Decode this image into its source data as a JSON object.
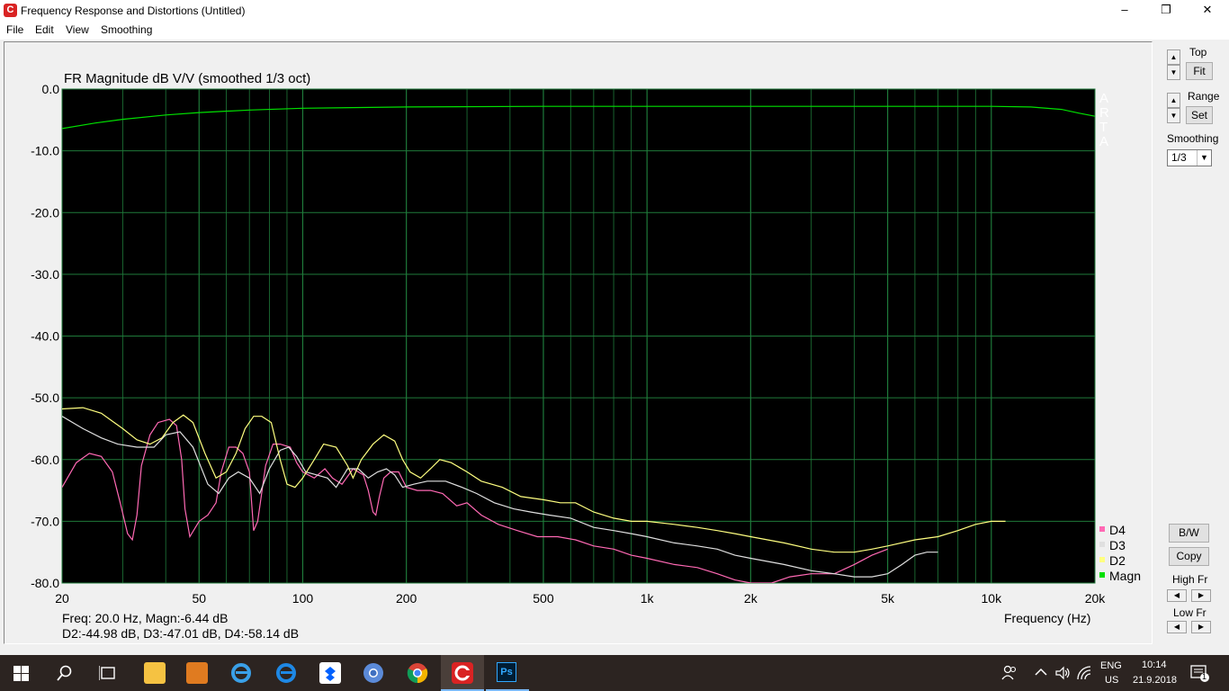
{
  "window": {
    "title": "Frequency Response and Distortions (Untitled)",
    "minimize": "–",
    "restore": "❐",
    "close": "✕"
  },
  "menu": [
    "File",
    "Edit",
    "View",
    "Smoothing"
  ],
  "plot": {
    "title": "FR Magnitude dB V/V (smoothed 1/3 oct)",
    "watermark": [
      "A",
      "R",
      "T",
      "A"
    ],
    "background": "#000000",
    "grid_color": "#1f7a3a"
  },
  "readout": {
    "line1": "Freq: 20.0 Hz, Magn:-6.44 dB",
    "line2": "D2:-44.98 dB, D3:-47.01 dB, D4:-58.14 dB"
  },
  "chart_data": {
    "type": "line",
    "title": "FR Magnitude dB V/V (smoothed 1/3 oct)",
    "xlabel": "Frequency (Hz)",
    "ylabel": "",
    "x_scale": "log",
    "xlim": [
      20,
      20000
    ],
    "ylim": [
      -80,
      0
    ],
    "x_ticks": [
      20,
      50,
      100,
      200,
      500,
      1000,
      2000,
      5000,
      10000,
      20000
    ],
    "x_tick_labels": [
      "20",
      "50",
      "100",
      "200",
      "500",
      "1k",
      "2k",
      "5k",
      "10k",
      "20k"
    ],
    "y_ticks": [
      0,
      -10,
      -20,
      -30,
      -40,
      -50,
      -60,
      -70,
      -80
    ],
    "y_tick_labels": [
      "0.0",
      "-10.0",
      "-20.0",
      "-30.0",
      "-40.0",
      "-50.0",
      "-60.0",
      "-70.0",
      "-80.0"
    ],
    "grid": true,
    "legend_position": "bottom-right",
    "series": [
      {
        "name": "Magn",
        "color": "#00e000",
        "points": [
          [
            20,
            -6.4
          ],
          [
            25,
            -5.5
          ],
          [
            30,
            -4.9
          ],
          [
            40,
            -4.2
          ],
          [
            50,
            -3.8
          ],
          [
            70,
            -3.4
          ],
          [
            100,
            -3.1
          ],
          [
            200,
            -2.9
          ],
          [
            500,
            -2.8
          ],
          [
            1000,
            -2.8
          ],
          [
            2000,
            -2.8
          ],
          [
            5000,
            -2.8
          ],
          [
            10000,
            -2.8
          ],
          [
            13000,
            -2.9
          ],
          [
            16000,
            -3.3
          ],
          [
            18000,
            -3.9
          ],
          [
            20000,
            -4.4
          ]
        ]
      },
      {
        "name": "D2",
        "color": "#ffff80",
        "points": [
          [
            20,
            -51.8
          ],
          [
            23,
            -51.6
          ],
          [
            26,
            -52.5
          ],
          [
            30,
            -55
          ],
          [
            33,
            -56.8
          ],
          [
            36,
            -57.5
          ],
          [
            39,
            -56.5
          ],
          [
            42,
            -54
          ],
          [
            45,
            -52.8
          ],
          [
            48,
            -54
          ],
          [
            52,
            -59
          ],
          [
            56,
            -63
          ],
          [
            60,
            -62
          ],
          [
            64,
            -59
          ],
          [
            68,
            -55
          ],
          [
            72,
            -53
          ],
          [
            76,
            -53
          ],
          [
            81,
            -54
          ],
          [
            86,
            -60
          ],
          [
            90,
            -64
          ],
          [
            95,
            -64.5
          ],
          [
            100,
            -63
          ],
          [
            108,
            -60
          ],
          [
            115,
            -57.5
          ],
          [
            125,
            -58
          ],
          [
            135,
            -61
          ],
          [
            140,
            -63
          ],
          [
            148,
            -60
          ],
          [
            160,
            -57.5
          ],
          [
            172,
            -56
          ],
          [
            185,
            -57
          ],
          [
            195,
            -60
          ],
          [
            205,
            -62
          ],
          [
            220,
            -63
          ],
          [
            235,
            -61.5
          ],
          [
            250,
            -60
          ],
          [
            270,
            -60.5
          ],
          [
            300,
            -62
          ],
          [
            330,
            -63.5
          ],
          [
            380,
            -64.5
          ],
          [
            430,
            -66
          ],
          [
            500,
            -66.5
          ],
          [
            560,
            -67
          ],
          [
            620,
            -67
          ],
          [
            700,
            -68.5
          ],
          [
            800,
            -69.5
          ],
          [
            900,
            -70
          ],
          [
            1000,
            -70
          ],
          [
            1200,
            -70.5
          ],
          [
            1400,
            -71
          ],
          [
            1600,
            -71.5
          ],
          [
            1800,
            -72
          ],
          [
            2000,
            -72.5
          ],
          [
            2500,
            -73.5
          ],
          [
            3000,
            -74.5
          ],
          [
            3500,
            -75
          ],
          [
            4000,
            -75
          ],
          [
            4500,
            -74.5
          ],
          [
            5000,
            -74
          ],
          [
            6000,
            -73
          ],
          [
            7000,
            -72.5
          ],
          [
            8000,
            -71.5
          ],
          [
            9000,
            -70.5
          ],
          [
            10000,
            -70
          ],
          [
            11000,
            -70
          ]
        ]
      },
      {
        "name": "D3",
        "color": "#e0e0e0",
        "points": [
          [
            20,
            -53
          ],
          [
            23,
            -55
          ],
          [
            26,
            -56.5
          ],
          [
            29,
            -57.5
          ],
          [
            33,
            -58
          ],
          [
            37,
            -58
          ],
          [
            40,
            -56
          ],
          [
            44,
            -55.5
          ],
          [
            48,
            -58
          ],
          [
            53,
            -64
          ],
          [
            57,
            -65.5
          ],
          [
            61,
            -63
          ],
          [
            65,
            -62
          ],
          [
            70,
            -63
          ],
          [
            75,
            -65.5
          ],
          [
            80,
            -61.5
          ],
          [
            86,
            -58.5
          ],
          [
            91,
            -58
          ],
          [
            96,
            -59.5
          ],
          [
            102,
            -62
          ],
          [
            110,
            -62.5
          ],
          [
            118,
            -63
          ],
          [
            125,
            -64.5
          ],
          [
            135,
            -61.5
          ],
          [
            145,
            -61.5
          ],
          [
            155,
            -63
          ],
          [
            165,
            -62
          ],
          [
            175,
            -61.5
          ],
          [
            185,
            -62.5
          ],
          [
            195,
            -64.5
          ],
          [
            210,
            -64
          ],
          [
            230,
            -63.5
          ],
          [
            260,
            -63.5
          ],
          [
            290,
            -64.5
          ],
          [
            320,
            -65.5
          ],
          [
            360,
            -67
          ],
          [
            410,
            -68
          ],
          [
            460,
            -68.5
          ],
          [
            520,
            -69
          ],
          [
            600,
            -69.5
          ],
          [
            700,
            -71
          ],
          [
            800,
            -71.5
          ],
          [
            900,
            -72
          ],
          [
            1000,
            -72.5
          ],
          [
            1200,
            -73.5
          ],
          [
            1400,
            -74
          ],
          [
            1600,
            -74.5
          ],
          [
            1800,
            -75.5
          ],
          [
            2000,
            -76
          ],
          [
            2500,
            -77
          ],
          [
            3000,
            -78
          ],
          [
            3500,
            -78.5
          ],
          [
            4000,
            -79
          ],
          [
            4500,
            -79
          ],
          [
            5000,
            -78.5
          ],
          [
            5500,
            -77
          ],
          [
            6000,
            -75.5
          ],
          [
            6500,
            -75
          ],
          [
            7000,
            -75
          ]
        ]
      },
      {
        "name": "D4",
        "color": "#ff69b4",
        "points": [
          [
            20,
            -64.5
          ],
          [
            22,
            -60.5
          ],
          [
            24,
            -59
          ],
          [
            26,
            -59.5
          ],
          [
            28,
            -62
          ],
          [
            29.5,
            -67
          ],
          [
            31,
            -72
          ],
          [
            32,
            -73
          ],
          [
            33,
            -69
          ],
          [
            34,
            -61
          ],
          [
            36,
            -56
          ],
          [
            38,
            -54
          ],
          [
            41,
            -53.5
          ],
          [
            43,
            -54.5
          ],
          [
            44.5,
            -60
          ],
          [
            45.5,
            -68
          ],
          [
            47,
            -72.5
          ],
          [
            50,
            -70
          ],
          [
            53,
            -69
          ],
          [
            56,
            -67
          ],
          [
            58,
            -62
          ],
          [
            61,
            -58
          ],
          [
            64,
            -58
          ],
          [
            67,
            -59
          ],
          [
            70,
            -62
          ],
          [
            72,
            -71.5
          ],
          [
            74,
            -70
          ],
          [
            78,
            -61
          ],
          [
            82,
            -57.5
          ],
          [
            86,
            -57.5
          ],
          [
            92,
            -58
          ],
          [
            96,
            -60.5
          ],
          [
            100,
            -62
          ],
          [
            108,
            -63
          ],
          [
            116,
            -61.5
          ],
          [
            122,
            -63
          ],
          [
            130,
            -64
          ],
          [
            140,
            -61.5
          ],
          [
            150,
            -62.5
          ],
          [
            155,
            -65
          ],
          [
            160,
            -68.5
          ],
          [
            163,
            -69
          ],
          [
            167,
            -66
          ],
          [
            172,
            -63
          ],
          [
            180,
            -62
          ],
          [
            190,
            -62
          ],
          [
            200,
            -64.5
          ],
          [
            215,
            -65
          ],
          [
            235,
            -65
          ],
          [
            255,
            -65.5
          ],
          [
            280,
            -67.5
          ],
          [
            300,
            -67
          ],
          [
            330,
            -69
          ],
          [
            370,
            -70.5
          ],
          [
            420,
            -71.5
          ],
          [
            480,
            -72.5
          ],
          [
            550,
            -72.5
          ],
          [
            620,
            -73
          ],
          [
            700,
            -74
          ],
          [
            800,
            -74.5
          ],
          [
            900,
            -75.5
          ],
          [
            1000,
            -76
          ],
          [
            1200,
            -77
          ],
          [
            1400,
            -77.5
          ],
          [
            1600,
            -78.5
          ],
          [
            1800,
            -79.5
          ],
          [
            2000,
            -80
          ],
          [
            2300,
            -80
          ],
          [
            2600,
            -79
          ],
          [
            3000,
            -78.5
          ],
          [
            3500,
            -78.5
          ],
          [
            4000,
            -77
          ],
          [
            4500,
            -75.5
          ],
          [
            5000,
            -74.5
          ]
        ]
      }
    ]
  },
  "sidebar": {
    "top_label": "Top",
    "fit_label": "Fit",
    "range_label": "Range",
    "set_label": "Set",
    "smoothing_label": "Smoothing",
    "smoothing_value": "1/3",
    "bw_label": "B/W",
    "copy_label": "Copy",
    "highfr_label": "High Fr",
    "lowfr_label": "Low Fr"
  },
  "taskbar": {
    "lang": "ENG",
    "layout": "US",
    "time": "10:14",
    "date": "21.9.2018",
    "notif_count": "1"
  }
}
